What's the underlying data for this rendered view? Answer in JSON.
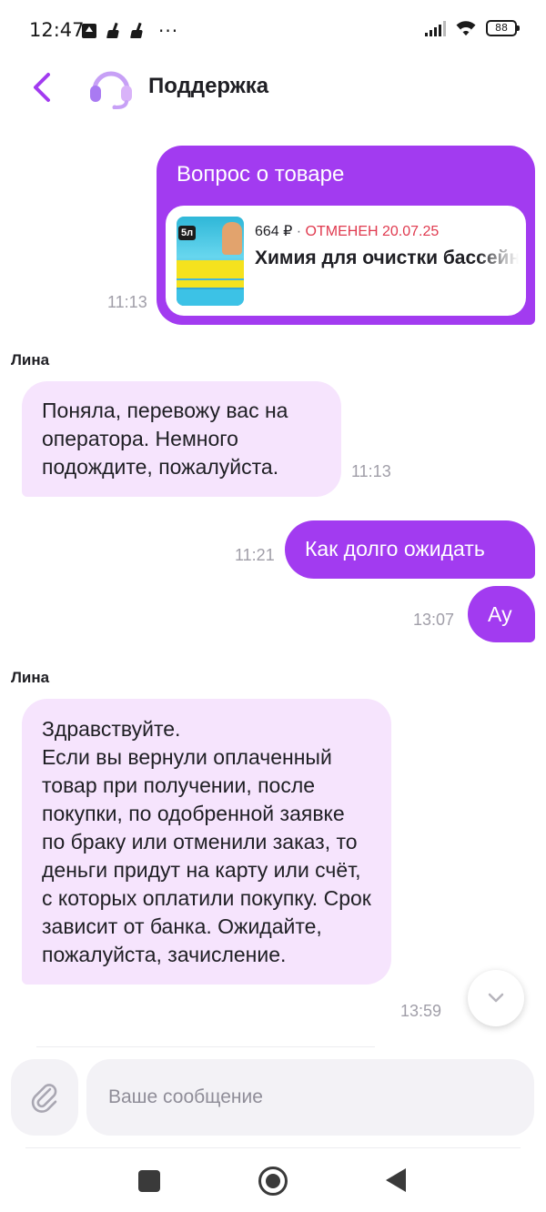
{
  "status_bar": {
    "time": "12:47",
    "dots": "···",
    "battery": "88"
  },
  "header": {
    "title": "Поддержка",
    "accent_color": "#a23bf0"
  },
  "messages": {
    "product_card": {
      "title": "Вопрос о товаре",
      "price": "664 ₽",
      "separator": " · ",
      "status": "ОТМЕНЕН 20.07.25",
      "name": "Химия для очистки бассейна",
      "thumb_badge": "5л",
      "time": "11:13"
    },
    "sender_1": "Лина",
    "msg_1": {
      "text": "Поняла, перевожу вас на оператора. Немного подождите, пожалуйста.",
      "time": "11:13"
    },
    "msg_2": {
      "text": "Как долго ожидать",
      "time": "11:21"
    },
    "msg_3": {
      "text": "Ау",
      "time": "13:07"
    },
    "sender_2": "Лина",
    "msg_4": {
      "text": "Здравствуйте.\nЕсли вы вернули оплаченный товар при получении, после покупки, по одобренной заявке по браку или отменили заказ, то деньги придут на карту или счёт, с которых оплатили покупку. Срок зависит от банка. Ожидайте, пожалуйста, зачисление.",
      "time": "13:59"
    }
  },
  "composer": {
    "placeholder": "Ваше сообщение"
  },
  "icons": {
    "back": "chevron-left-icon",
    "support": "headset-icon",
    "attach": "paperclip-icon",
    "scroll_down": "chevron-down-icon"
  }
}
